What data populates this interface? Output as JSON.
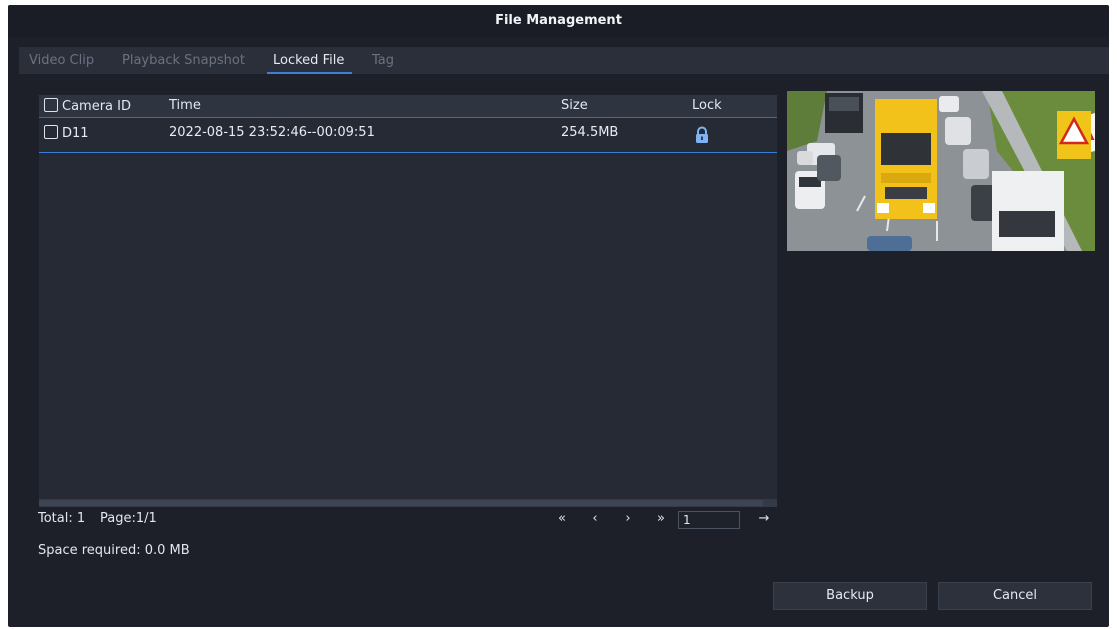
{
  "window": {
    "title": "File Management"
  },
  "tabs": [
    {
      "label": "Video Clip"
    },
    {
      "label": "Playback Snapshot"
    },
    {
      "label": "Locked File"
    },
    {
      "label": "Tag"
    }
  ],
  "active_tab": "Locked File",
  "table": {
    "columns": [
      "Camera ID",
      "Time",
      "Size",
      "Lock"
    ],
    "rows": [
      {
        "camera_id": "D11",
        "time": "2022-08-15 23:52:46--00:09:51",
        "size": "254.5MB",
        "lock_icon": "padlock-icon"
      }
    ]
  },
  "status": {
    "total": "Total: 1",
    "page": "Page:1/1",
    "space_required": "Space required: 0.0 MB"
  },
  "pager": {
    "first": "«",
    "prev": "‹",
    "next": "›",
    "last": "»",
    "page_value": "1",
    "go": "→"
  },
  "buttons": {
    "backup": "Backup",
    "cancel": "Cancel"
  },
  "colors": {
    "accent": "#3d7fd6",
    "background": "#1d2029",
    "truck": "#f2c21a"
  }
}
